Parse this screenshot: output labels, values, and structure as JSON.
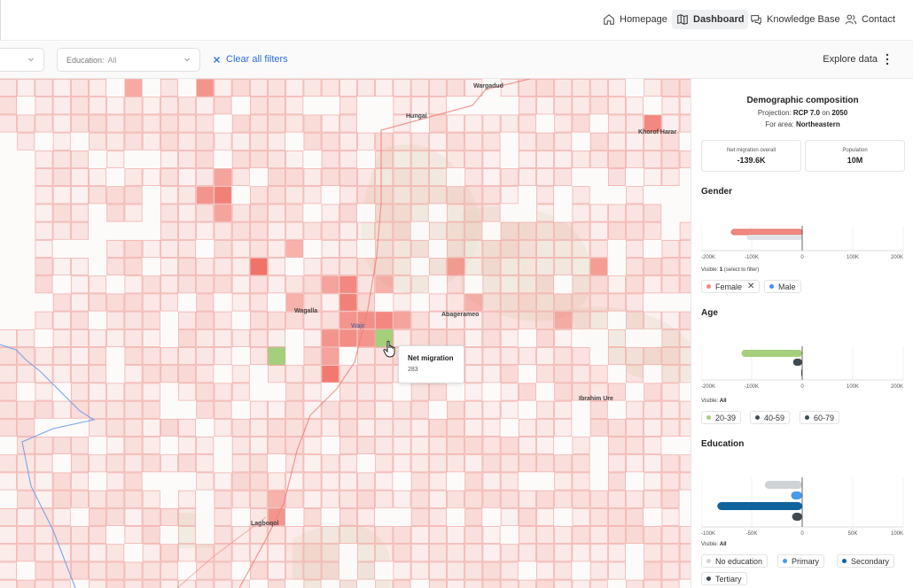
{
  "nav": {
    "items": [
      {
        "label": "Homepage",
        "icon": "home-icon",
        "active": false
      },
      {
        "label": "Dashboard",
        "icon": "map-icon",
        "active": true
      },
      {
        "label": "Knowledge Base",
        "icon": "chat-icon",
        "active": false
      },
      {
        "label": "Contact",
        "icon": "users-icon",
        "active": false
      }
    ]
  },
  "filters": {
    "education": {
      "label": "Education:",
      "value": "All"
    },
    "clear_label": "Clear all filters",
    "explore_label": "Explore data"
  },
  "map": {
    "places": [
      "Wargadud",
      "Hungai",
      "Khorof Harar",
      "Wagalla",
      "Wajir",
      "Abagerameo",
      "Ibrahim Ure",
      "Lagboqol"
    ],
    "tooltip": {
      "title": "Net migration",
      "value": "283"
    },
    "colors": {
      "cell_outline": "#f1a9a3",
      "cell_fill": "#ef6b60",
      "highlight": "#a6cf7d",
      "road": "#ef7f78",
      "river": "#7aa3e8"
    }
  },
  "panel": {
    "title": "Demographic composition",
    "projection_prefix": "Projection:",
    "projection": "RCP 7.0",
    "on_word": "on",
    "year": "2050",
    "area_prefix": "For area:",
    "area": "Northeastern",
    "stats": [
      {
        "label": "Net migration overall",
        "value": "-139.6K"
      },
      {
        "label": "Population",
        "value": "10M"
      }
    ],
    "visible_label": "Visible:",
    "gender": {
      "title": "Gender",
      "visible": "1",
      "visible_hint": "(select to filter)",
      "chips": [
        {
          "label": "Female",
          "color": "#f08a80",
          "removable": true
        },
        {
          "label": "Male",
          "color": "#4a8ef0",
          "removable": false
        }
      ]
    },
    "age": {
      "title": "Age",
      "visible": "All",
      "chips": [
        {
          "label": "20-39",
          "color": "#a6cf7d"
        },
        {
          "label": "40-59",
          "color": "#3f4a52"
        },
        {
          "label": "60-79",
          "color": "#3f4a52"
        }
      ]
    },
    "education": {
      "title": "Education",
      "visible": "All",
      "chips": [
        {
          "label": "No education",
          "color": "#cfd3d6"
        },
        {
          "label": "Primary",
          "color": "#4a9ae8"
        },
        {
          "label": "Secondary",
          "color": "#10639c"
        },
        {
          "label": "Tertiary",
          "color": "#3f4a52"
        }
      ]
    }
  },
  "chart_data": [
    {
      "type": "bar",
      "title": "Gender",
      "xticks": [
        "-200K",
        "-100K",
        "0",
        "100K",
        "200K"
      ],
      "xlim": [
        -200000,
        200000
      ],
      "series": [
        {
          "name": "Female",
          "values": [
            -140000
          ],
          "color": "#f08a80"
        },
        {
          "name": "Male",
          "values": [
            -110000
          ],
          "color": "#e1e4e6"
        }
      ]
    },
    {
      "type": "bar",
      "title": "Age",
      "xticks": [
        "-200K",
        "-100K",
        "0",
        "100K",
        "200K"
      ],
      "xlim": [
        -200000,
        200000
      ],
      "series": [
        {
          "name": "20-39",
          "values": [
            -120000
          ],
          "color": "#a6cf7d"
        },
        {
          "name": "40-59",
          "values": [
            -18000
          ],
          "color": "#3f4a52"
        },
        {
          "name": "60-79",
          "values": [
            -2000
          ],
          "color": "#3f4a52"
        }
      ]
    },
    {
      "type": "bar",
      "title": "Education",
      "xticks": [
        "-100K",
        "-50K",
        "0",
        "50K",
        "100K"
      ],
      "xlim": [
        -100000,
        100000
      ],
      "series": [
        {
          "name": "No education",
          "values": [
            -37000
          ],
          "color": "#cfd3d6"
        },
        {
          "name": "Primary",
          "values": [
            -11000
          ],
          "color": "#4a9ae8"
        },
        {
          "name": "Secondary",
          "values": [
            -84000
          ],
          "color": "#10639c"
        },
        {
          "name": "Tertiary",
          "values": [
            -10000
          ],
          "color": "#3f4a52"
        }
      ]
    }
  ]
}
